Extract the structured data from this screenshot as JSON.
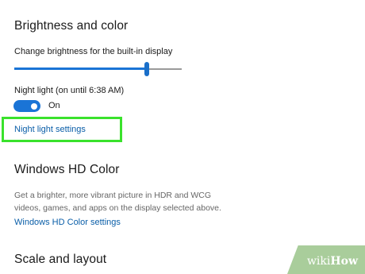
{
  "brightness": {
    "title": "Brightness and color",
    "slider_label": "Change brightness for the built-in display",
    "brightness_level_percent": 79
  },
  "night_light": {
    "label": "Night light (on until 6:38 AM)",
    "toggle_state": "On",
    "toggle_on": true,
    "settings_link": "Night light settings"
  },
  "hd_color": {
    "title": "Windows HD Color",
    "description": "Get a brighter, more vibrant picture in HDR and WCG videos, games, and apps on the display selected above.",
    "settings_link": "Windows HD Color settings"
  },
  "scale": {
    "title": "Scale and layout"
  },
  "watermark": {
    "prefix": "wiki",
    "suffix": "How"
  },
  "colors": {
    "accent": "#1a74d6",
    "link": "#0a5ea8",
    "highlight": "#3ae22c",
    "watermark": "#9ac489"
  }
}
